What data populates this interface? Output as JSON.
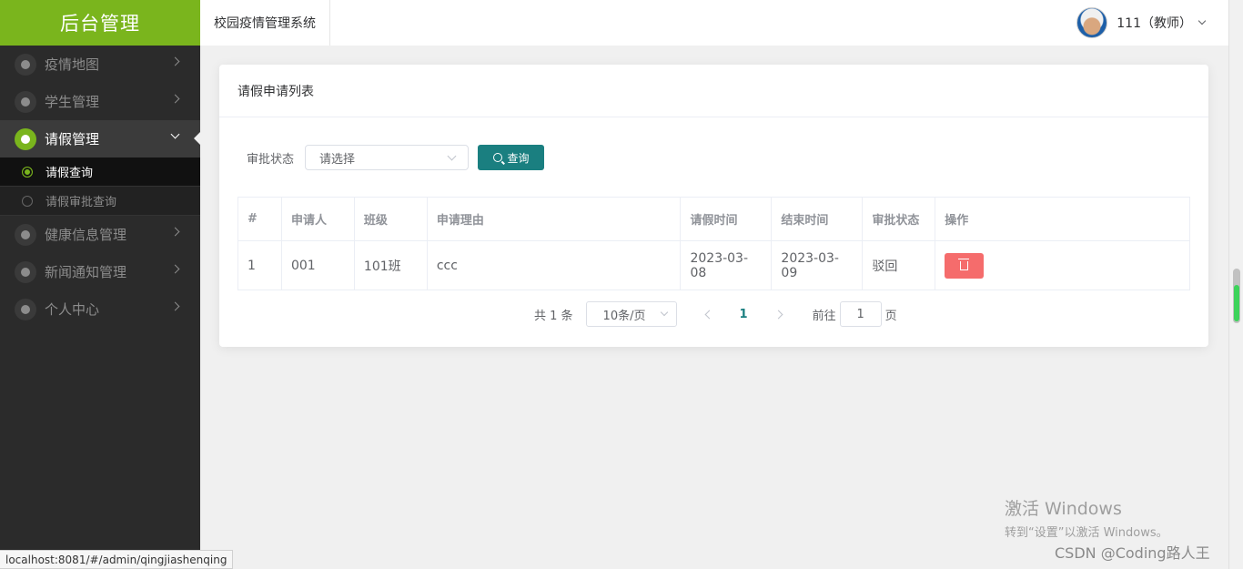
{
  "sidebar": {
    "brand": "后台管理",
    "items": [
      {
        "label": "疫情地图"
      },
      {
        "label": "学生管理"
      },
      {
        "label": "请假管理"
      },
      {
        "label": "健康信息管理"
      },
      {
        "label": "新闻通知管理"
      },
      {
        "label": "个人中心"
      }
    ],
    "sub_items": [
      {
        "label": "请假查询"
      },
      {
        "label": "请假审批查询"
      }
    ]
  },
  "header": {
    "system_title": "校园疫情管理系统",
    "user": "111（教师）"
  },
  "card": {
    "title": "请假申请列表",
    "filter": {
      "label": "审批状态",
      "placeholder": "请选择",
      "query_button": "查询"
    },
    "table": {
      "columns": [
        "#",
        "申请人",
        "班级",
        "申请理由",
        "请假时间",
        "结束时间",
        "审批状态",
        "操作"
      ],
      "rows": [
        {
          "index": "1",
          "applicant": "001",
          "class": "101班",
          "reason": "ccc",
          "start": "2023-03-08",
          "end": "2023-03-09",
          "status": "驳回"
        }
      ]
    },
    "pagination": {
      "total": "共 1 条",
      "page_size": "10条/页",
      "current": "1",
      "goto_prefix": "前往",
      "goto_value": "1",
      "goto_suffix": "页"
    }
  },
  "statusbar": {
    "url": "localhost:8081/#/admin/qingjiashenqing"
  },
  "watermark": {
    "activate_title": "激活 Windows",
    "activate_sub": "转到“设置”以激活 Windows。",
    "csdn": "CSDN @Coding路人王"
  },
  "colors": {
    "brand_green": "#7ab51d",
    "primary": "#1a7f80",
    "danger": "#f56c6c"
  }
}
